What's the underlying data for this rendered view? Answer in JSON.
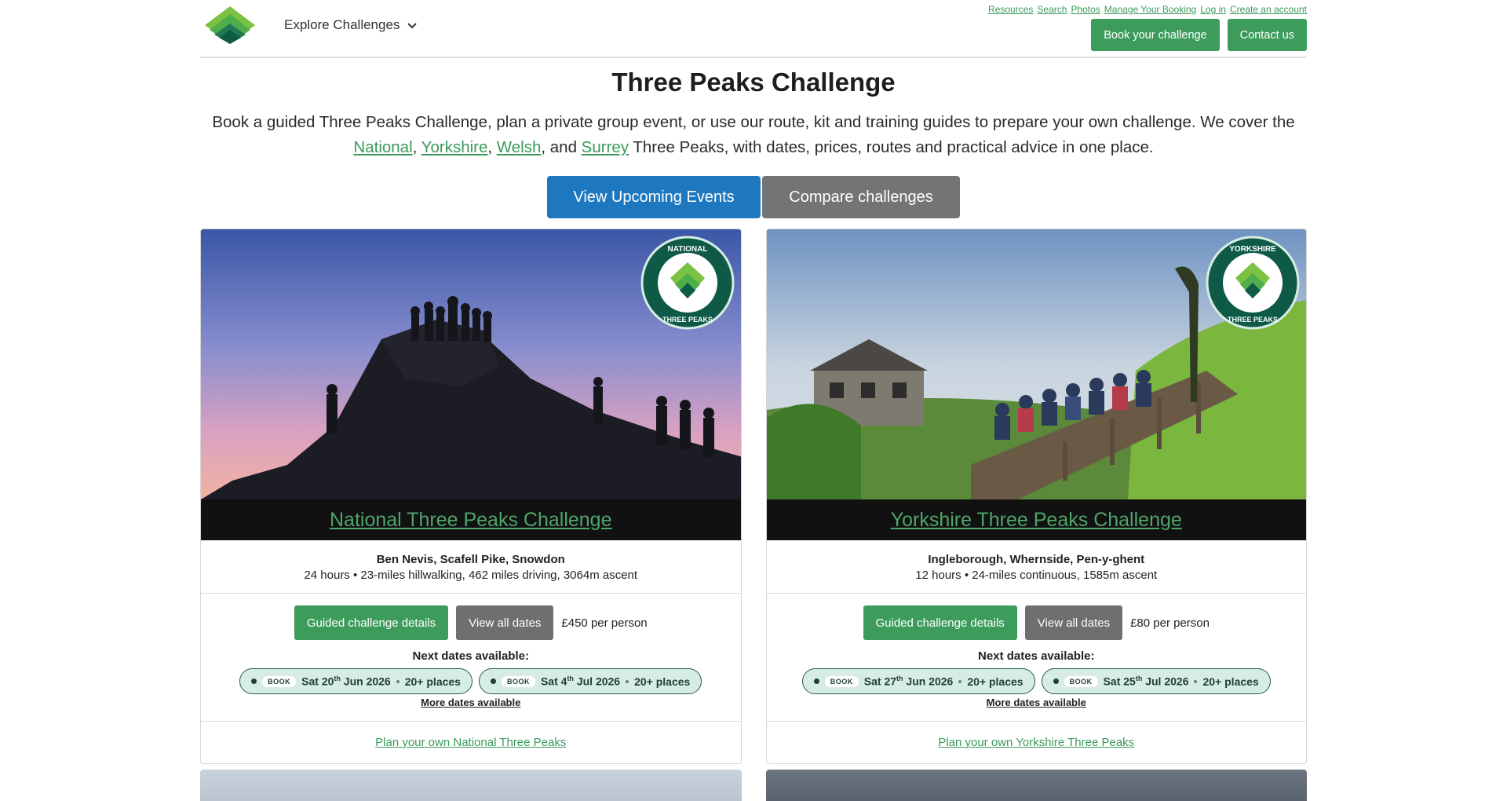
{
  "header": {
    "explore_label": "Explore Challenges",
    "top_links": [
      "Resources",
      "Search",
      "Photos",
      "Manage Your Booking",
      "Log in",
      "Create an account"
    ],
    "book_button": "Book your challenge",
    "contact_button": "Contact us"
  },
  "hero": {
    "title": "Three Peaks Challenge",
    "text_1": "Book a guided Three Peaks Challenge, plan a private group event, or use our route, kit and training guides to prepare your own challenge. We cover the",
    "links": [
      "National",
      "Yorkshire",
      "Welsh",
      "Surrey"
    ],
    "sep_1": ", ",
    "sep_2": ", ",
    "sep_3": ", and ",
    "text_2": " Three Peaks, with dates, prices, routes and practical advice in one place.",
    "primary_button": "View Upcoming Events",
    "secondary_button": "Compare challenges"
  },
  "cards": [
    {
      "badge_top": "NATIONAL",
      "badge_bottom": "THREE PEAKS",
      "title": "National Three Peaks Challenge",
      "peaks": "Ben Nevis, Scafell Pike, Snowdon",
      "details": "24 hours • 23-miles hillwalking, 462 miles driving, 3064m ascent",
      "guided_button": "Guided challenge details",
      "dates_button": "View all dates",
      "price": "£450 per person",
      "next_label": "Next dates available:",
      "dates": [
        {
          "book": "BOOK",
          "day": "Sat 20",
          "sup": "th",
          "rest": " Jun 2026",
          "places": "20+ places"
        },
        {
          "book": "BOOK",
          "day": "Sat 4",
          "sup": "th",
          "rest": " Jul 2026",
          "places": "20+ places"
        }
      ],
      "more_link": "More dates available",
      "plan_link": "Plan your own National Three Peaks"
    },
    {
      "badge_top": "YORKSHIRE",
      "badge_bottom": "THREE PEAKS",
      "title": "Yorkshire Three Peaks Challenge",
      "peaks": "Ingleborough, Whernside, Pen-y-ghent",
      "details": "12 hours • 24-miles continuous, 1585m ascent",
      "guided_button": "Guided challenge details",
      "dates_button": "View all dates",
      "price": "£80 per person",
      "next_label": "Next dates available:",
      "dates": [
        {
          "book": "BOOK",
          "day": "Sat 27",
          "sup": "th",
          "rest": " Jun 2026",
          "places": "20+ places"
        },
        {
          "book": "BOOK",
          "day": "Sat 25",
          "sup": "th",
          "rest": " Jul 2026",
          "places": "20+ places"
        }
      ],
      "more_link": "More dates available",
      "plan_link": "Plan your own Yorkshire Three Peaks"
    }
  ]
}
